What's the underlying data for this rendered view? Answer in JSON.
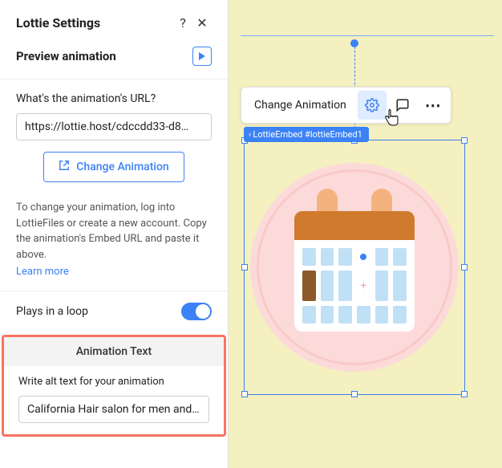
{
  "panel": {
    "title": "Lottie Settings",
    "preview_label": "Preview animation",
    "url_question": "What's the animation's URL?",
    "url_value": "https://lottie.host/cdccdd33-d8…",
    "change_btn": "Change Animation",
    "help_text": "To change your animation, log into LottieFiles or create a new account. Copy the animation's Embed URL and paste it above.",
    "learn_more": "Learn more",
    "loop_label": "Plays in a loop",
    "anim_text_header": "Animation Text",
    "alt_question": "Write alt text for your animation",
    "alt_value": "California Hair salon for men and…"
  },
  "toolbar": {
    "change": "Change Animation"
  },
  "badge": "LottieEmbed #lottieEmbed1",
  "icons": {
    "help": "?",
    "close": "✕",
    "play": "▶",
    "open": "↗",
    "gear": "⚙",
    "chat": "💬",
    "more": "⋯",
    "hand": "👆",
    "chev": "‹"
  }
}
